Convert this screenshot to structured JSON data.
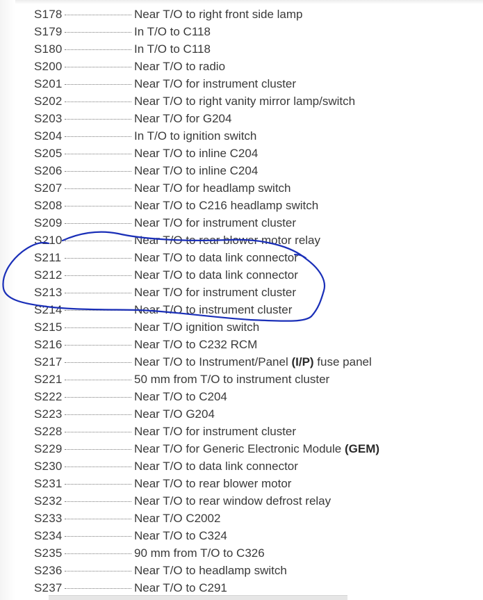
{
  "splice_list": [
    {
      "code": "S178",
      "desc": "Near T/O to right front side lamp"
    },
    {
      "code": "S179",
      "desc": "In T/O to C118"
    },
    {
      "code": "S180",
      "desc": "In T/O to C118"
    },
    {
      "code": "S200",
      "desc": "Near T/O to radio"
    },
    {
      "code": "S201",
      "desc": "Near T/O for instrument cluster"
    },
    {
      "code": "S202",
      "desc": "Near T/O to right vanity mirror lamp/switch"
    },
    {
      "code": "S203",
      "desc": "Near T/O for G204"
    },
    {
      "code": "S204",
      "desc": "In T/O to ignition switch"
    },
    {
      "code": "S205",
      "desc": "Near T/O to inline C204"
    },
    {
      "code": "S206",
      "desc": "Near T/O to inline C204"
    },
    {
      "code": "S207",
      "desc": "Near T/O for headlamp switch"
    },
    {
      "code": "S208",
      "desc": "Near T/O to C216 headlamp switch"
    },
    {
      "code": "S209",
      "desc": "Near T/O for instrument cluster"
    },
    {
      "code": "S210",
      "desc": "Near T/O to rear blower motor relay"
    },
    {
      "code": "S211",
      "desc": "Near T/O to data link connector"
    },
    {
      "code": "S212",
      "desc": "Near T/O to data link connector"
    },
    {
      "code": "S213",
      "desc": "Near T/O for instrument cluster"
    },
    {
      "code": "S214",
      "desc": "Near T/O to instrument cluster"
    },
    {
      "code": "S215",
      "desc": "Near T/O ignition switch"
    },
    {
      "code": "S216",
      "desc": "Near T/O to C232 RCM"
    },
    {
      "code": "S217",
      "desc": "Near T/O to Instrument/Panel ",
      "bold": "(I/P)",
      "desc_after": " fuse panel"
    },
    {
      "code": "S221",
      "desc": "50 mm from T/O to instrument cluster"
    },
    {
      "code": "S222",
      "desc": "Near T/O to C204"
    },
    {
      "code": "S223",
      "desc": "Near T/O G204"
    },
    {
      "code": "S228",
      "desc": "Near T/O for instrument cluster"
    },
    {
      "code": "S229",
      "desc": "Near T/O for Generic Electronic Module ",
      "bold": "(GEM)",
      "desc_after": ""
    },
    {
      "code": "S230",
      "desc": "Near T/O to data link connector"
    },
    {
      "code": "S231",
      "desc": "Near T/O to rear blower motor"
    },
    {
      "code": "S232",
      "desc": "Near T/O to rear window defrost relay"
    },
    {
      "code": "S233",
      "desc": "Near T/O C2002"
    },
    {
      "code": "S234",
      "desc": "Near T/O to C324"
    },
    {
      "code": "S235",
      "desc": "90 mm from T/O to C326"
    },
    {
      "code": "S236",
      "desc": "Near T/O to headlamp switch"
    },
    {
      "code": "S237",
      "desc": "Near T/O to C291"
    }
  ],
  "colors": {
    "text": "#3a3a3a",
    "annotation_ink": "#1a2fb8"
  }
}
